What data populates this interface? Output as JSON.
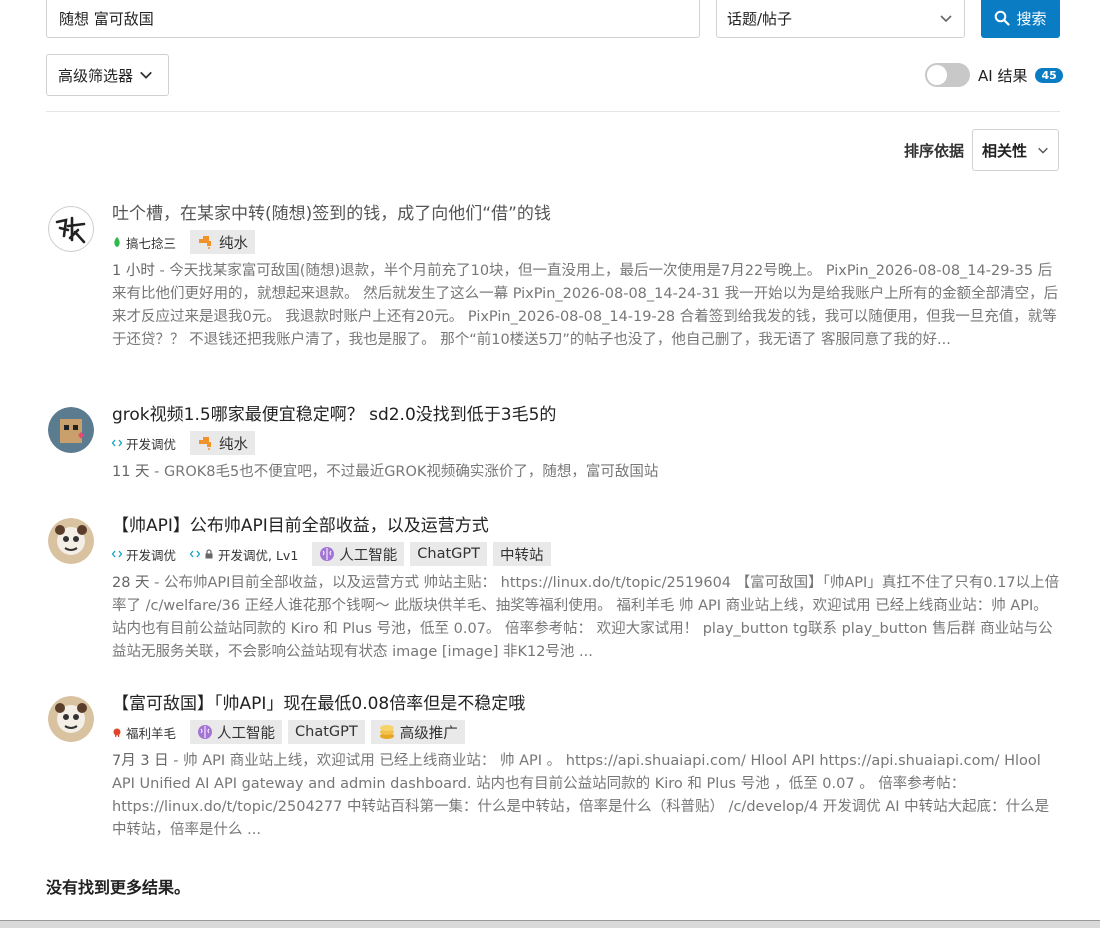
{
  "search": {
    "query": "随想 富可敌国",
    "type_value": "话题/帖子",
    "button_label": "搜索"
  },
  "filters": {
    "advanced_label": "高级筛选器",
    "ai_label": "AI 结果",
    "ai_count": "45",
    "sort_label": "排序依据",
    "sort_value": "相关性"
  },
  "results": [
    {
      "title": "吐个槽，在某家中转(随想)签到的钱，成了向他们“借”的钱",
      "category": "搞七捻三",
      "tags": [
        "纯水"
      ],
      "date": "1 小时",
      "excerpt": "今天找某家富可敌国(随想)退款，半个月前充了10块，但一直没用上，最后一次使用是7月22号晚上。 PixPin_2026-08-08_14-29-35 后来有比他们更好用的，就想起来退款。 然后就发生了这么一幕 PixPin_2026-08-08_14-24-31 我一开始以为是给我账户上所有的金额全部清空，后来才反应过来是退我0元。 我退款时账户上还有20元。 PixPin_2026-08-08_14-19-28 合着签到给我发的钱，我可以随便用，但我一旦充值，就等于还贷？？ 不退钱还把我账户清了，我也是服了。 那个“前10楼送5刀”的帖子也没了，他自己删了，我无语了 客服同意了我的好..."
    },
    {
      "title": "grok视频1.5哪家最便宜稳定啊？ sd2.0没找到低于3毛5的",
      "category": "开发调优",
      "tags": [
        "纯水"
      ],
      "date": "11 天",
      "excerpt": "GROK8毛5也不便宜吧，不过最近GROK视频确实涨价了，随想，富可敌国站"
    },
    {
      "title": "【帅API】公布帅API目前全部收益，以及运营方式",
      "category": "开发调优",
      "subcategory": "开发调优, Lv1",
      "tags": [
        "人工智能",
        "ChatGPT",
        "中转站"
      ],
      "date": "28 天",
      "excerpt": "公布帅API目前全部收益，以及运营方式 帅站主贴： https://linux.do/t/topic/2519604 【富可敌国】「帅API」真扛不住了只有0.17以上倍率了 /c/welfare/36 正经人谁花那个钱啊〜 此版块供羊毛、抽奖等福利使用。 福利羊毛 帅 API 商业站上线，欢迎试用 已经上线商业站：帅 API。 站内也有目前公益站同款的 Kiro 和 Plus 号池，低至 0.07。 倍率参考帖： 欢迎大家试用！ play_button tg联系 play_button 售后群 商业站与公益站无服务关联，不会影响公益站现有状态 image [image] 非K12号池 ..."
    },
    {
      "title": "【富可敌国】「帅API」现在最低0.08倍率但是不稳定哦",
      "category": "福利羊毛",
      "tags": [
        "人工智能",
        "ChatGPT",
        "高级推广"
      ],
      "date": "7月 3 日",
      "excerpt": "帅 API 商业站上线，欢迎试用 已经上线商业站： 帅 API 。 https://api.shuaiapi.com/ Hlool API https://api.shuaiapi.com/ Hlool API Unified AI API gateway and admin dashboard. 站内也有目前公益站同款的 Kiro 和 Plus 号池 ，低至 0.07 。 倍率参考帖： https://linux.do/t/topic/2504277 中转站百科第一集：什么是中转站，倍率是什么（科普贴） /c/develop/4 开发调优 AI 中转站大起底：什么是中转站，倍率是什么 ..."
    }
  ],
  "footer": {
    "no_more": "没有找到更多结果。"
  },
  "colors": {
    "accent": "#0a7cc4",
    "tag_bg": "#e9e9e9",
    "water_icon": "#f0932b",
    "ai_icon": "#a374d6",
    "category_green": "#2db94d",
    "category_blue": "#0ea5c6",
    "category_red": "#e0452b"
  }
}
